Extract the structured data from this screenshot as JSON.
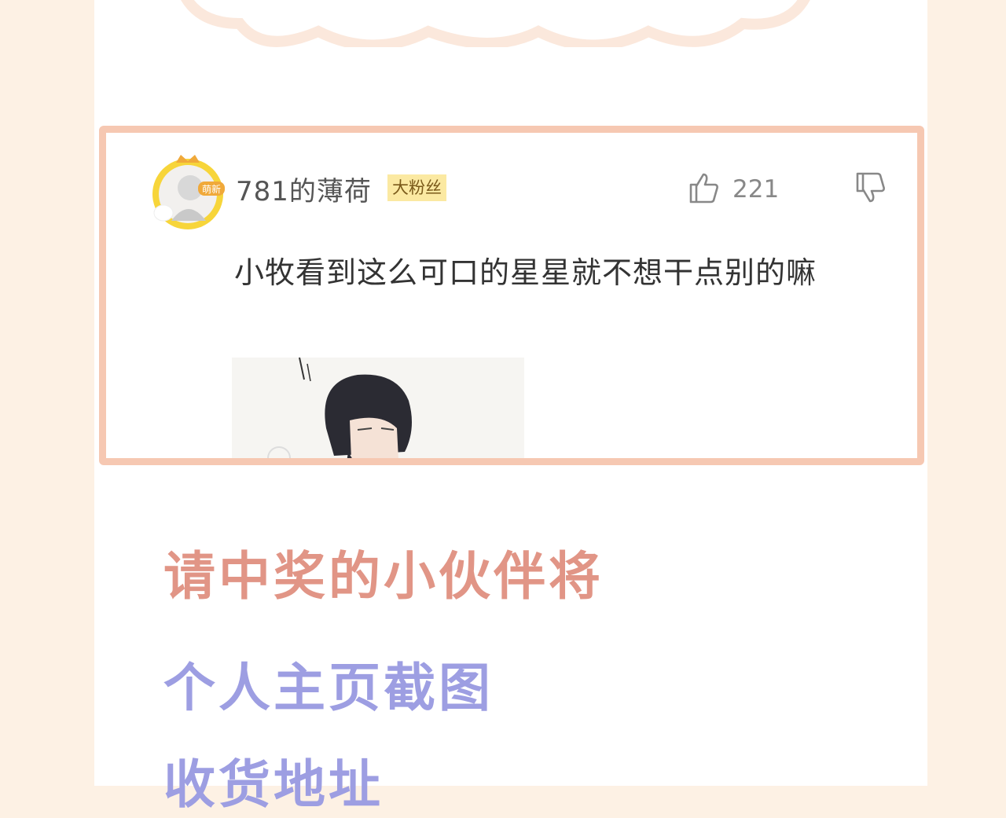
{
  "comment": {
    "username": "781的薄荷",
    "badge": "大粉丝",
    "avatar_tag": "萌新",
    "like_count": "221",
    "text": "小牧看到这么可口的星星就不想干点别的嘛"
  },
  "announcement": {
    "line1": "请中奖的小伙伴将",
    "line2": "个人主页截图",
    "line3": "收货地址"
  },
  "colors": {
    "background": "#fdf1e4",
    "card_border": "#f6c8b2",
    "headline_pink": "#e19586",
    "headline_purple": "#9d9ee2",
    "badge_bg": "#fbe9a2"
  },
  "icons": [
    "thumbs-up-icon",
    "thumbs-down-icon"
  ]
}
